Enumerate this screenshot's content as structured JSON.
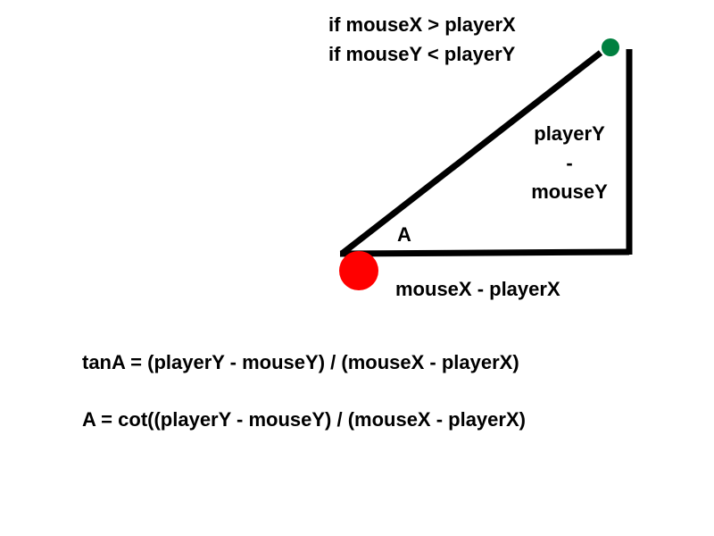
{
  "conditions": {
    "line1": "if mouseX > playerX",
    "line2": "if mouseY < playerY"
  },
  "vertical_side": {
    "line1": "playerY",
    "line2": "-",
    "line3": "mouseY"
  },
  "angle_label": "A",
  "horizontal_side": "mouseX - playerX",
  "formulas": {
    "tan": "tanA = (playerY - mouseY) / (mouseX - playerX)",
    "angle": "A = cot((playerY - mouseY) / (mouseX - playerX)"
  },
  "colors": {
    "player": "#ff0000",
    "mouse": "#008040",
    "lines": "#000000"
  }
}
